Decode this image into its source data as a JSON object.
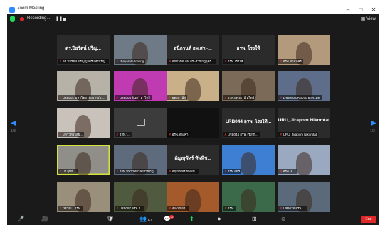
{
  "window": {
    "title": "Zoom Meeting",
    "minimize": "–",
    "maximize": "□",
    "close": "✕"
  },
  "topbar": {
    "recording_label": "Recording...",
    "view_label": "View"
  },
  "pager": {
    "left_page": "1/3",
    "right_page": "1/3"
  },
  "tiles": [
    {
      "big": "ดร.ปิยรัตน์ ปริญ...",
      "label": "ดร.ปิยรัตน์ ปริญญาตรีแห่งปริญ...",
      "color": "#2b2b2b"
    },
    {
      "big": "",
      "label": "chayaratn tonting",
      "color": "#6e7a85"
    },
    {
      "big": "อนิกานต์ อพ.สร.-...",
      "label": "อนิกานต์ อพ.สร.-ราชภัฏอุตร...",
      "color": "#2b2b2b"
    },
    {
      "big": "อรพ. โรงให้",
      "label": "อรพ.โรงให้",
      "color": "#2b2b2b"
    },
    {
      "big": "",
      "label": "อรพ.สกลนคร",
      "color": "#b49a7c"
    },
    {
      "big": "",
      "label": "LRB001 มหาวิทยาลัยราชภัฏ...",
      "color": "#b7b2a8"
    },
    {
      "big": "",
      "label": "LRB003 จันทร์ สาวิตรี",
      "color": "#c03ab1"
    },
    {
      "big": "",
      "label": "อุดรธานีสู่",
      "color": "#c9b088"
    },
    {
      "big": "",
      "label": "อรพ.อุดรธานี สโตร์",
      "color": "#7b6a57"
    },
    {
      "big": "",
      "label": "LRB050 LRB070 อรพ.เทพ",
      "color": "#5e6e8a"
    },
    {
      "big": "",
      "label": "มหาวิทยาลัย...",
      "color": "#c8c2ba"
    },
    {
      "big": "",
      "label": "อรพ.ใ...",
      "color": "#3c3c3c"
    },
    {
      "big": "",
      "label": "อรพ.ทองคำ",
      "color": "#111111"
    },
    {
      "big": "LRB044 อรพ. โรงให้...",
      "label": "LRB044 อรพ.โรงให้...",
      "color": "#2b2b2b"
    },
    {
      "big": "URU_Jirapom Nikomtat",
      "label": "URU_Jirapom Nikomtat",
      "color": "#2b2b2b"
    },
    {
      "big": "",
      "label": "ปริ ฤทธิ์ ...",
      "color": "#8f8e88"
    },
    {
      "big": "",
      "label": "อรพ.มหาวิทยาลัยราชภัฏ...",
      "color": "#5e6b7d"
    },
    {
      "big": "อัญญุพัทร์ ทัพพิช...",
      "label": "อัญญุพัทร์ ทัพพิช...",
      "color": "#2b2b2b"
    },
    {
      "big": "",
      "label": "อรพ.อุดร",
      "color": "#3e7fd3"
    },
    {
      "big": "",
      "label": "อรพ. อ...",
      "color": "#9aa8c0"
    },
    {
      "big": "",
      "label": "ปีศาจไ...อรพ.",
      "color": "#9a8f7a"
    },
    {
      "big": "",
      "label": "LRB097 อรพ.อ...",
      "color": "#4f5a3f"
    },
    {
      "big": "",
      "label": "iPad ของ...",
      "color": "#a45a2a"
    },
    {
      "big": "",
      "label": "อรพ.",
      "color": "#3a6a4a"
    },
    {
      "big": "",
      "label": "LRB078 อรพ. ...",
      "color": "#5a6a7a"
    }
  ],
  "toolbar": {
    "mic_icon": "🎤",
    "video_icon": "🎥",
    "security_icon": "🛡",
    "participants_icon": "👥",
    "participants_count": "67",
    "chat_icon": "💬",
    "chat_badge": "12",
    "share_icon": "⬆",
    "record_icon": "⏺",
    "breakout_icon": "⊞",
    "reactions_icon": "☺",
    "more_icon": "⋯",
    "end_label": "End"
  }
}
